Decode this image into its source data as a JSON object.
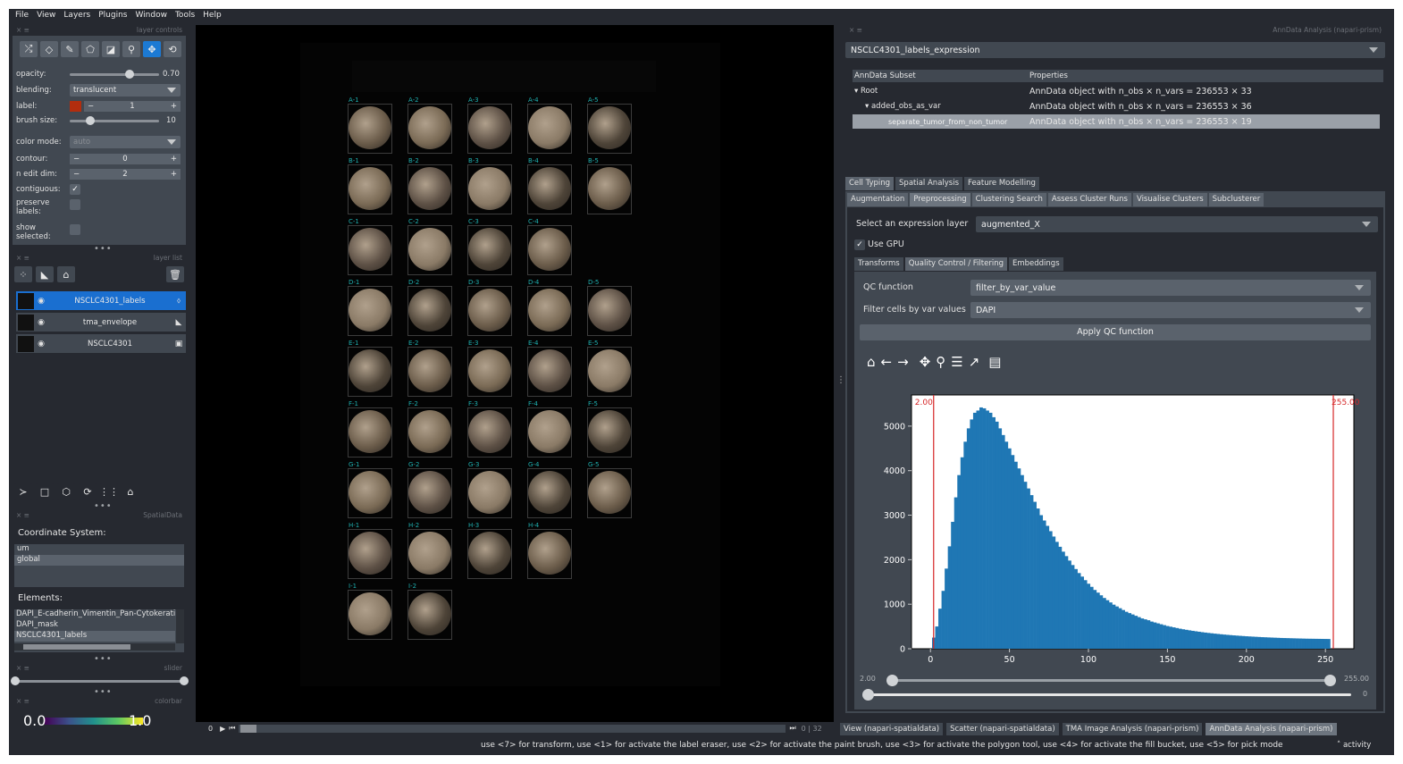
{
  "menu": [
    "File",
    "View",
    "Layers",
    "Plugins",
    "Window",
    "Tools",
    "Help"
  ],
  "layer_controls": {
    "header": "layer controls",
    "opacity_label": "opacity:",
    "opacity_value": "0.70",
    "blending_label": "blending:",
    "blending_value": "translucent",
    "label_label": "label:",
    "label_value": "1",
    "label_color": "#b22d0e",
    "brush_label": "brush size:",
    "brush_value": "10",
    "color_mode_label": "color mode:",
    "color_mode_value": "auto",
    "contour_label": "contour:",
    "contour_value": "0",
    "nedit_label": "n edit dim:",
    "nedit_value": "2",
    "contiguous_label": "contiguous:",
    "preserve_label_1": "preserve",
    "preserve_label_2": "labels:",
    "show_label_1": "show",
    "show_label_2": "selected:"
  },
  "layer_list": {
    "header": "layer list",
    "layers": [
      "NSCLC4301_labels",
      "tma_envelope",
      "NSCLC4301"
    ]
  },
  "spatialdata": {
    "header": "SpatialData",
    "coord_title": "Coordinate System:",
    "coords": [
      "um",
      "global"
    ],
    "elements_title": "Elements:",
    "elements": [
      "DAPI_E-cadherin_Vimentin_Pan-Cytokerati",
      "DAPI_mask",
      "NSCLC4301_labels"
    ]
  },
  "slider_header": "slider",
  "colorbar": {
    "header": "colorbar",
    "min": "0.0",
    "max": "1.0"
  },
  "canvas": {
    "frame_start": "0",
    "frame_info": "0 | 32",
    "cores": [
      [
        "A-1",
        "A-2",
        "A-3",
        "A-4",
        "A-5"
      ],
      [
        "B-1",
        "B-2",
        "B-3",
        "B-4",
        "B-5"
      ],
      [
        "C-1",
        "C-2",
        "C-3",
        "C-4",
        ""
      ],
      [
        "D-1",
        "D-2",
        "D-3",
        "D-4",
        "D-5"
      ],
      [
        "E-1",
        "E-2",
        "E-3",
        "E-4",
        "E-5"
      ],
      [
        "F-1",
        "F-2",
        "F-3",
        "F-4",
        "F-5"
      ],
      [
        "G-1",
        "G-2",
        "G-3",
        "G-4",
        "G-5"
      ],
      [
        "H-1",
        "H-2",
        "H-3",
        "H-4",
        ""
      ],
      [
        "I-1",
        "I-2",
        "",
        "",
        ""
      ]
    ]
  },
  "right": {
    "header": "AnnData Analysis (napari-prism)",
    "dataset": "NSCLC4301_labels_expression",
    "tree_headers": [
      "AnnData Subset",
      "Properties"
    ],
    "tree": [
      {
        "name": "Root",
        "prop": "AnnData object with n_obs × n_vars = 236553 × 33"
      },
      {
        "name": "added_obs_as_var",
        "prop": "AnnData object with n_obs × n_vars = 236553 × 36"
      },
      {
        "name": "separate_tumor_from_non_tumor",
        "prop": "AnnData object with n_obs × n_vars = 236553 × 19"
      }
    ],
    "tabs1": [
      "Cell Typing",
      "Spatial Analysis",
      "Feature Modelling"
    ],
    "tabs2": [
      "Augmentation",
      "Preprocessing",
      "Clustering Search",
      "Assess Cluster Runs",
      "Visualise Clusters",
      "Subclusterer"
    ],
    "expr_label": "Select an expression layer",
    "expr_value": "augmented_X",
    "gpu_label": "Use GPU",
    "tabs3": [
      "Transforms",
      "Quality Control / Filtering",
      "Embeddings"
    ],
    "qc_label": "QC function",
    "qc_value": "filter_by_var_value",
    "filter_label": "Filter cells by var values",
    "filter_value": "DAPI",
    "apply_label": "Apply QC function",
    "range_min": "2.00",
    "range_max": "255.00",
    "second_slider_value": "0"
  },
  "chart_data": {
    "type": "bar",
    "xlim": [
      -12,
      268
    ],
    "ylim": [
      0,
      5700
    ],
    "xticks": [
      0,
      50,
      100,
      150,
      200,
      250
    ],
    "yticks": [
      0,
      1000,
      2000,
      3000,
      4000,
      5000
    ],
    "bar_color": "#1f77b4",
    "threshold_color": "#d62728",
    "thresholds": [
      2,
      255
    ],
    "threshold_labels": [
      "2.00",
      "255.00"
    ],
    "bin_width": 2,
    "x": [
      2,
      4,
      6,
      8,
      10,
      12,
      14,
      16,
      18,
      20,
      22,
      24,
      26,
      28,
      30,
      32,
      34,
      36,
      38,
      40,
      42,
      44,
      46,
      48,
      50,
      52,
      54,
      56,
      58,
      60,
      62,
      64,
      66,
      68,
      70,
      72,
      74,
      76,
      78,
      80,
      82,
      84,
      86,
      88,
      90,
      92,
      94,
      96,
      98,
      100,
      102,
      104,
      106,
      108,
      110,
      112,
      114,
      116,
      118,
      120,
      122,
      124,
      126,
      128,
      130,
      132,
      134,
      136,
      138,
      140,
      142,
      144,
      146,
      148,
      150,
      152,
      154,
      156,
      158,
      160,
      162,
      164,
      166,
      168,
      170,
      172,
      174,
      176,
      178,
      180,
      182,
      184,
      186,
      188,
      190,
      192,
      194,
      196,
      198,
      200,
      202,
      204,
      206,
      208,
      210,
      212,
      214,
      216,
      218,
      220,
      222,
      224,
      226,
      228,
      230,
      232,
      234,
      236,
      238,
      240,
      242,
      244,
      246,
      248,
      250,
      252
    ],
    "values": [
      250,
      500,
      900,
      1300,
      1800,
      2300,
      2850,
      3400,
      3900,
      4300,
      4650,
      4950,
      5150,
      5300,
      5350,
      5420,
      5400,
      5350,
      5300,
      5200,
      5100,
      4950,
      4800,
      4650,
      4500,
      4350,
      4200,
      4050,
      3900,
      3750,
      3600,
      3450,
      3300,
      3150,
      3000,
      2880,
      2760,
      2640,
      2520,
      2400,
      2290,
      2180,
      2080,
      1980,
      1880,
      1790,
      1700,
      1620,
      1540,
      1460,
      1390,
      1320,
      1260,
      1200,
      1140,
      1090,
      1040,
      990,
      950,
      910,
      870,
      830,
      800,
      770,
      740,
      710,
      680,
      660,
      640,
      610,
      590,
      570,
      550,
      530,
      510,
      495,
      480,
      465,
      450,
      437,
      425,
      413,
      402,
      392,
      382,
      372,
      363,
      355,
      347,
      339,
      332,
      325,
      318,
      312,
      306,
      300,
      295,
      290,
      285,
      280,
      276,
      272,
      268,
      264,
      260,
      257,
      254,
      251,
      248,
      245,
      242,
      240,
      238,
      236,
      234,
      232,
      230,
      228,
      226,
      225,
      224,
      223,
      222,
      221,
      220,
      219,
      200,
      150
    ]
  },
  "bottom_tabs": [
    "View (napari-spatialdata)",
    "Scatter (napari-spatialdata)",
    "TMA Image Analysis (napari-prism)",
    "AnnData Analysis (napari-prism)"
  ],
  "status": "use <7> for transform, use <1> for activate the label eraser, use <2> for activate the paint brush, use <3> for activate the polygon tool, use <4> for activate the fill bucket, use <5> for pick mode",
  "activity": "activity"
}
